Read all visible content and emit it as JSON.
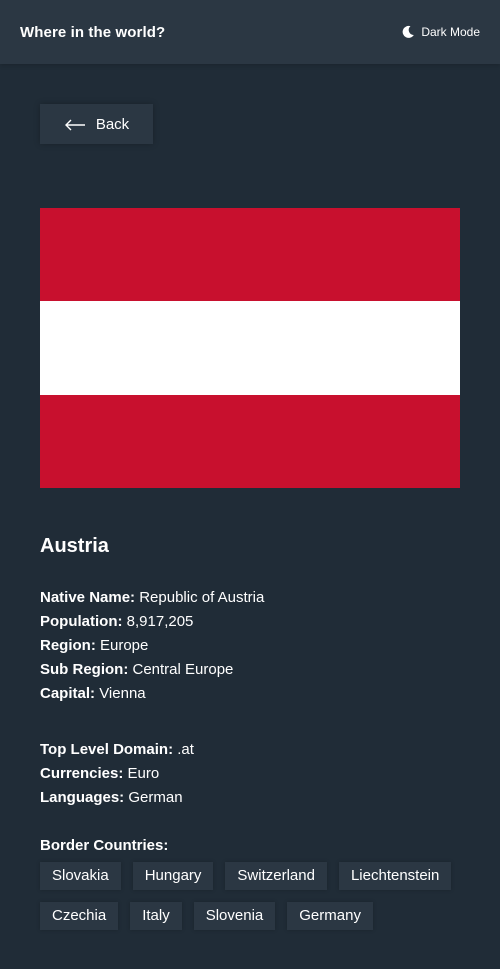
{
  "header": {
    "title": "Where in the world?",
    "toggle_label": "Dark Mode",
    "toggle_icon": "moon-icon"
  },
  "back_button": {
    "label": "Back",
    "icon": "arrow-left-icon"
  },
  "flag": {
    "colors": [
      "#c8102e",
      "#ffffff",
      "#c8102e"
    ]
  },
  "country": {
    "name": "Austria",
    "details_primary": [
      {
        "label": "Native Name:",
        "value": "Republic of Austria"
      },
      {
        "label": "Population:",
        "value": "8,917,205"
      },
      {
        "label": "Region:",
        "value": "Europe"
      },
      {
        "label": "Sub Region:",
        "value": "Central Europe"
      },
      {
        "label": "Capital:",
        "value": "Vienna"
      }
    ],
    "details_secondary": [
      {
        "label": "Top Level Domain:",
        "value": ".at"
      },
      {
        "label": "Currencies:",
        "value": "Euro"
      },
      {
        "label": "Languages:",
        "value": "German"
      }
    ],
    "border_title": "Border Countries:",
    "borders": [
      "Slovakia",
      "Hungary",
      "Switzerland",
      "Liechtenstein",
      "Czechia",
      "Italy",
      "Slovenia",
      "Germany"
    ]
  },
  "colors": {
    "background": "#202c37",
    "element": "#2b3743",
    "text": "#ffffff"
  }
}
